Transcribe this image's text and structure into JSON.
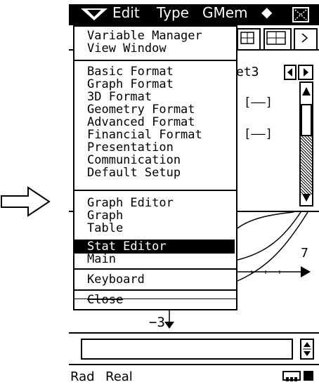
{
  "menubar": {
    "items": [
      "Edit",
      "Type",
      "GMem"
    ],
    "diamond": "◆"
  },
  "dropdown": {
    "group1": [
      "Variable Manager",
      "View Window"
    ],
    "group2": [
      "Basic Format",
      "Graph Format",
      "3D Format",
      "Geometry Format",
      "Advanced Format",
      "Financial Format",
      "Presentation",
      "Communication",
      "Default Setup"
    ],
    "group3": [
      "Graph Editor",
      "Graph",
      "Table",
      "Stat Editor",
      "Main"
    ],
    "group4": [
      "Keyboard"
    ],
    "group5": [
      "Close"
    ],
    "selected": "Stat Editor"
  },
  "sheet": {
    "tab_label": "et3",
    "bracket_text": "[——]"
  },
  "graph": {
    "label_right": "7",
    "label_bottom": "−3"
  },
  "status": {
    "angle": "Rad",
    "mode": "Real"
  }
}
